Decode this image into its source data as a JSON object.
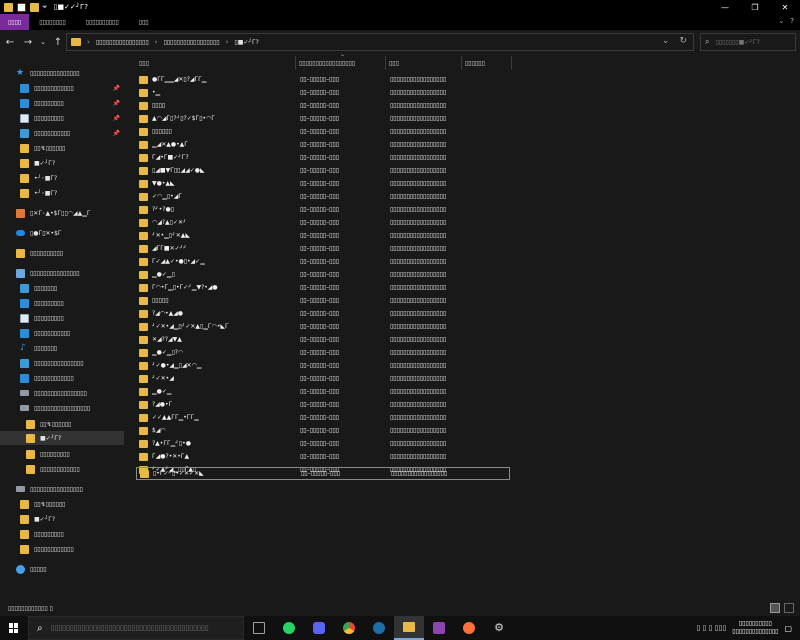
{
  "window": {
    "title": "▯■✓✓╯Г?",
    "minimize": "—",
    "maximize": "❐",
    "close": "✕"
  },
  "ribbon": {
    "tabs": [
      "▯▯▯▯",
      "▯▯▯▯▯▯▯▯",
      "▯▯▯▯▯▯▯▯▯▯",
      "▯▯▯"
    ],
    "help": "?"
  },
  "address": {
    "crumbs": [
      "▯▯▯▯▯▯▯▯▯▯▯▯▯▯▯▯",
      "▯▯▯▯▯▯▯▯▯▯▯▯▯▯▯▯▯",
      "▯■✓╯Г?"
    ],
    "separator": "›",
    "dropdown": "⌄",
    "refresh": "↻"
  },
  "search": {
    "placeholder": "▯▯▯▯▯▯▯■✓╯Г?"
  },
  "nav": {
    "back": "←",
    "forward": "→",
    "recent": "⌄",
    "up": "↑"
  },
  "sidebar": {
    "items": [
      {
        "label": "▯▯▯▯▯▯▯▯▯▯▯▯▯▯▯",
        "icon": "star-icon",
        "pinned": false
      },
      {
        "label": "▯▯▯▯▯▯▯▯▯▯▯▯",
        "icon": "desktop-icon",
        "pinned": true
      },
      {
        "label": "▯▯▯▯▯▯▯▯▯",
        "icon": "download-icon",
        "pinned": true
      },
      {
        "label": "▯▯▯▯▯▯▯▯▯",
        "icon": "documents-icon",
        "pinned": true
      },
      {
        "label": "▯▯▯▯▯▯▯▯▯▯▯",
        "icon": "pictures-icon",
        "pinned": true
      },
      {
        "label": "▯▯↯▯▯▯▯▯▯",
        "icon": "folder-icon",
        "pinned": false
      },
      {
        "label": "■✓╯Г?",
        "icon": "folder-icon",
        "pinned": false
      },
      {
        "label": "•╯◦■Г?",
        "icon": "folder-icon",
        "pinned": false
      },
      {
        "label": "•╯◦■Г?",
        "icon": "folder-icon",
        "pinned": false
      },
      {
        "label": "▯✕Г◦▲•$Г▯▯◠◢▲▁Г",
        "icon": "app-folder-icon",
        "pinned": false
      },
      {
        "label": "▯●Г▯✕•$Г",
        "icon": "onedrive-icon",
        "pinned": false
      },
      {
        "label": "▯▯▯▯▯▯▯▯▯▯",
        "icon": "share-icon",
        "pinned": false
      },
      {
        "label": "▯▯▯▯▯▯▯▯▯▯▯▯▯▯▯",
        "icon": "this-pc-icon",
        "pinned": false
      },
      {
        "label": "▯▯▯▯▯▯▯",
        "icon": "3d-objects-icon",
        "pinned": false
      },
      {
        "label": "▯▯▯▯▯▯▯▯▯",
        "icon": "desktop-icon",
        "pinned": false
      },
      {
        "label": "▯▯▯▯▯▯▯▯▯",
        "icon": "documents-icon",
        "pinned": false
      },
      {
        "label": "▯▯▯▯▯▯▯▯▯▯▯",
        "icon": "download-icon",
        "pinned": false
      },
      {
        "label": "▯▯▯▯▯▯▯",
        "icon": "music-icon",
        "pinned": false
      },
      {
        "label": "▯▯▯▯▯▯▯▯▯▯▯▯▯▯▯",
        "icon": "pictures-icon",
        "pinned": false
      },
      {
        "label": "▯▯▯▯▯▯▯▯▯▯▯▯",
        "icon": "videos-icon",
        "pinned": false
      },
      {
        "label": "▯▯▯▯▯▯▯▯▯▯▯▯▯▯▯▯",
        "icon": "drive-icon",
        "pinned": false
      },
      {
        "label": "▯▯▯▯▯▯▯▯▯▯▯▯▯▯▯▯▯",
        "icon": "drive-icon",
        "pinned": false
      },
      {
        "label": "▯▯↯▯▯▯▯▯▯",
        "icon": "folder-icon",
        "pinned": false
      },
      {
        "label": "■✓╯Г?",
        "icon": "folder-icon",
        "pinned": false
      },
      {
        "label": "▯▯▯▯▯▯▯▯▯",
        "icon": "folder-icon",
        "pinned": false
      },
      {
        "label": "▯▯▯▯▯▯▯▯▯▯▯▯",
        "icon": "folder-icon",
        "pinned": false
      },
      {
        "label": "▯▯▯▯▯▯▯▯▯▯▯▯▯▯▯▯",
        "icon": "drive-icon",
        "pinned": false
      },
      {
        "label": "▯▯↯▯▯▯▯▯▯",
        "icon": "folder-icon",
        "pinned": false
      },
      {
        "label": "■✓╯Г?",
        "icon": "folder-icon",
        "pinned": false
      },
      {
        "label": "▯▯▯▯▯▯▯▯▯",
        "icon": "folder-icon",
        "pinned": false
      },
      {
        "label": "▯▯▯▯▯▯▯▯▯▯▯▯",
        "icon": "folder-icon",
        "pinned": false
      },
      {
        "label": "▯▯▯▯▯",
        "icon": "network-icon",
        "pinned": false
      }
    ]
  },
  "columns": [
    "▯▯▯",
    "▯▯▯▯▯▯▯▯▯▯▯▯▯▯▯▯▯",
    "▯▯▯",
    "▯▯▯▯▯▯"
  ],
  "files": [
    {
      "name": "●ГГ▁▁◢✕▯?◢ГГ▁",
      "date": "▯▯–▯▯▯▯▯–▯▯▯",
      "type": "▯▯▯▯▯▯▯▯▯▯▯▯▯▯▯▯▯"
    },
    {
      "name": "•▁",
      "date": "▯▯–▯▯▯▯▯–▯▯▯",
      "type": "▯▯▯▯▯▯▯▯▯▯▯▯▯▯▯▯▯"
    },
    {
      "name": "▯▯▯▯",
      "date": "▯▯–▯▯▯▯▯–▯▯▯",
      "type": "▯▯▯▯▯▯▯▯▯▯▯▯▯▯▯▯▯"
    },
    {
      "name": "▲◠◢Г▯?╯▯?✓$Г▯•◠Г",
      "date": "▯▯–▯▯▯▯▯–▯▯▯",
      "type": "▯▯▯▯▯▯▯▯▯▯▯▯▯▯▯▯▯"
    },
    {
      "name": "▯▯▯▯▯▯",
      "date": "▯▯–▯▯▯▯▯–▯▯▯",
      "type": "▯▯▯▯▯▯▯▯▯▯▯▯▯▯▯▯▯"
    },
    {
      "name": "▁◢✕▲●•▲Г",
      "date": "▯▯–▯▯▯▯▯–▯▯▯",
      "type": "▯▯▯▯▯▯▯▯▯▯▯▯▯▯▯▯▯"
    },
    {
      "name": "Г◢•Г■✓╯Г?",
      "date": "▯▯–▯▯▯▯▯–▯▯▯",
      "type": "▯▯▯▯▯▯▯▯▯▯▯▯▯▯▯▯▯"
    },
    {
      "name": "▯◢■▼Г▯▯◢◢✓●◣",
      "date": "▯▯–▯▯▯▯▯–▯▯▯",
      "type": "▯▯▯▯▯▯▯▯▯▯▯▯▯▯▯▯▯"
    },
    {
      "name": "▼●•▲◣",
      "date": "▯▯–▯▯▯▯▯–▯▯▯",
      "type": "▯▯▯▯▯▯▯▯▯▯▯▯▯▯▯▯▯"
    },
    {
      "name": "✓◠▁▯•◢Г",
      "date": "▯▯–▯▯▯▯▯–▯▯▯",
      "type": "▯▯▯▯▯▯▯▯▯▯▯▯▯▯▯▯▯"
    },
    {
      "name": "?╯•?●▯",
      "date": "▯▯–▯▯▯▯▯–▯▯▯",
      "type": "▯▯▯▯▯▯▯▯▯▯▯▯▯▯▯▯▯"
    },
    {
      "name": "◠◢?▲▯✓✕╯",
      "date": "▯▯–▯▯▯▯▯–▯▯▯",
      "type": "▯▯▯▯▯▯▯▯▯▯▯▯▯▯▯▯▯"
    },
    {
      "name": "╯✕•▁▯╯✕▲◣",
      "date": "▯▯–▯▯▯▯▯–▯▯▯",
      "type": "▯▯▯▯▯▯▯▯▯▯▯▯▯▯▯▯▯"
    },
    {
      "name": "◢ГГ■✕✓╯╯",
      "date": "▯▯–▯▯▯▯▯–▯▯▯",
      "type": "▯▯▯▯▯▯▯▯▯▯▯▯▯▯▯▯▯"
    },
    {
      "name": "Г✓◢▲✓•●▯•◢✓▁",
      "date": "▯▯–▯▯▯▯▯–▯▯▯",
      "type": "▯▯▯▯▯▯▯▯▯▯▯▯▯▯▯▯▯"
    },
    {
      "name": "▁●✓▁▯",
      "date": "▯▯–▯▯▯▯▯–▯▯▯",
      "type": "▯▯▯▯▯▯▯▯▯▯▯▯▯▯▯▯▯"
    },
    {
      "name": "Г◠•Г▁▯•Г✓╯▁▼?•◢●",
      "date": "▯▯–▯▯▯▯▯–▯▯▯",
      "type": "▯▯▯▯▯▯▯▯▯▯▯▯▯▯▯▯▯"
    },
    {
      "name": "▯▯▯▯▯",
      "date": "▯▯–▯▯▯▯▯–▯▯▯",
      "type": "▯▯▯▯▯▯▯▯▯▯▯▯▯▯▯▯▯"
    },
    {
      "name": "?◢◠•▲◢●",
      "date": "▯▯–▯▯▯▯▯–▯▯▯",
      "type": "▯▯▯▯▯▯▯▯▯▯▯▯▯▯▯▯▯"
    },
    {
      "name": "╯✓✕•◢▁▯╯✓✕▲▯▁Г◠•◣Г",
      "date": "▯▯–▯▯▯▯▯–▯▯▯",
      "type": "▯▯▯▯▯▯▯▯▯▯▯▯▯▯▯▯▯"
    },
    {
      "name": "✕◢??◢▼▲",
      "date": "▯▯–▯▯▯▯▯–▯▯▯",
      "type": "▯▯▯▯▯▯▯▯▯▯▯▯▯▯▯▯▯"
    },
    {
      "name": "▁●✓▁▯?◠",
      "date": "▯▯–▯▯▯▯▯–▯▯▯",
      "type": "▯▯▯▯▯▯▯▯▯▯▯▯▯▯▯▯▯"
    },
    {
      "name": "╯✓●•◢▁▯◢✕◠▁",
      "date": "▯▯–▯▯▯▯▯–▯▯▯",
      "type": "▯▯▯▯▯▯▯▯▯▯▯▯▯▯▯▯▯"
    },
    {
      "name": "╯✓✕•◢",
      "date": "▯▯–▯▯▯▯▯–▯▯▯",
      "type": "▯▯▯▯▯▯▯▯▯▯▯▯▯▯▯▯▯"
    },
    {
      "name": "▁●✓▁",
      "date": "▯▯–▯▯▯▯▯–▯▯▯",
      "type": "▯▯▯▯▯▯▯▯▯▯▯▯▯▯▯▯▯"
    },
    {
      "name": "?◢●•Г",
      "date": "▯▯–▯▯▯▯▯–▯▯▯",
      "type": "▯▯▯▯▯▯▯▯▯▯▯▯▯▯▯▯▯"
    },
    {
      "name": "✓✓▲▲ГГ▁•ГГ▁",
      "date": "▯▯–▯▯▯▯▯–▯▯▯",
      "type": "▯▯▯▯▯▯▯▯▯▯▯▯▯▯▯▯▯"
    },
    {
      "name": "$◢◠",
      "date": "▯▯–▯▯▯▯▯–▯▯▯",
      "type": "▯▯▯▯▯▯▯▯▯▯▯▯▯▯▯▯▯"
    },
    {
      "name": "?▲•ГГ▁╯▯•●",
      "date": "▯▯–▯▯▯▯▯–▯▯▯",
      "type": "▯▯▯▯▯▯▯▯▯▯▯▯▯▯▯▯▯"
    },
    {
      "name": "Г◢●?•✕•Г▲",
      "date": "▯▯–▯▯▯▯▯–▯▯▯",
      "type": "▯▯▯▯▯▯▯▯▯▯▯▯▯▯▯▯▯"
    },
    {
      "name": "╯✓▲╯◢▁▯▯Г▲▯",
      "date": "▯▯–▯▯▯▯▯–▯▯▯",
      "type": "▯▯▯▯▯▯▯▯▯▯▯▯▯▯▯▯▯"
    },
    {
      "name": "▯•Г✓╯▯•✓✕✓✕◣",
      "date": "▯▯–▯▯▯▯▯–▯▯▯",
      "type": "▯▯▯▯▯▯▯▯▯▯▯▯▯▯▯▯▯"
    }
  ],
  "status": {
    "item_count": "▯▯▯▯▯▯▯▯▯▯▯▯ ▯"
  },
  "taskbar": {
    "search_placeholder": "▯▯▯▯▯▯▯▯▯▯▯▯▯▯▯▯▯▯▯▯▯▯▯▯▯▯▯▯▯▯▯▯▯▯▯▯▯▯▯▯▯",
    "apps": [
      {
        "name": "task-view-icon",
        "color": "#9aa0a6"
      },
      {
        "name": "whatsapp-icon",
        "color": "#25d366"
      },
      {
        "name": "discord-icon",
        "color": "#5865f2"
      },
      {
        "name": "chrome-icon",
        "color": "#e8453c"
      },
      {
        "name": "steam-icon",
        "color": "#1b6ea8"
      },
      {
        "name": "file-explorer-icon",
        "color": "#e9b945"
      },
      {
        "name": "app-c-icon",
        "color": "#8e44ad"
      },
      {
        "name": "firefox-icon",
        "color": "#ff7139"
      },
      {
        "name": "settings-icon",
        "color": "#cfcfcf"
      }
    ],
    "tray": "▯ ▯ ▯ ▯▯▯",
    "time": "▯▯▯▯▯▯▯▯▯▯",
    "date": "▯▯▯▯▯▯▯▯▯▯▯▯▯▯",
    "notifications": "▢"
  },
  "colors": {
    "accent_file_tab": "#7a2a9a",
    "folder": "#e9b945",
    "background": "#191919",
    "titlebar": "#000000"
  }
}
